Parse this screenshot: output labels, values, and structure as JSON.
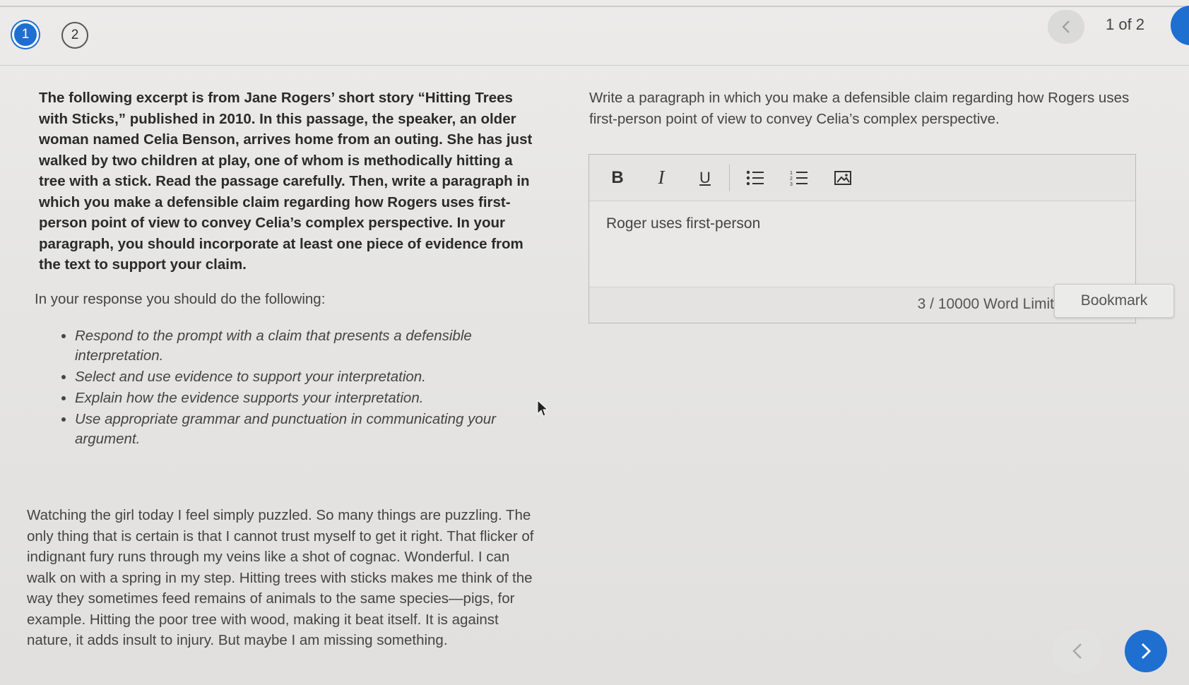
{
  "header": {
    "question_numbers": [
      "1",
      "2"
    ],
    "page_indicator": "1 of 2"
  },
  "left": {
    "intro": "The following excerpt is from Jane Rogers’ short story “Hitting Trees with Sticks,” published in 2010. In this passage, the speaker, an older woman named Celia Benson, arrives home from an outing. She has just walked by two children at play, one of whom is methodically hitting a tree with a stick. Read the passage carefully. Then, write a paragraph in which you make a defensible claim regarding how Rogers uses first-person point of view to convey Celia’s complex perspective. In your paragraph, you should incorporate at least one piece of evidence from the text to support your claim.",
    "response_heading": "In your response you should do the following:",
    "bullets": [
      "Respond to the prompt with a claim that presents a defensible interpretation.",
      "Select and use evidence to support your interpretation.",
      "Explain how the evidence supports your interpretation.",
      "Use appropriate grammar and punctuation in communicating your argument."
    ],
    "passage": "Watching the girl today I feel simply puzzled. So many things are puzzling. The only thing that is certain is that I cannot trust myself to get it right. That flicker of indignant fury runs through my veins like a shot of cognac. Wonderful. I can walk on with a spring in my step. Hitting trees with sticks makes me think of the way they sometimes feed remains of animals to the same species—pigs, for example. Hitting the poor tree with wood, making it beat itself. It is against nature, it adds insult to injury. But maybe I am missing something."
  },
  "right": {
    "prompt": "Write a paragraph in which you make a defensible claim regarding how Rogers uses first-person point of view to convey Celia’s complex perspective.",
    "toolbar": {
      "bold": "B",
      "italic": "I",
      "underline": "U"
    },
    "editor_value": "Roger uses first-person",
    "word_count": "3 / 10000 Word Limit",
    "bookmark_label": "Bookmark"
  },
  "colors": {
    "accent": "#1f6fd1",
    "background": "#e6e5e3"
  }
}
